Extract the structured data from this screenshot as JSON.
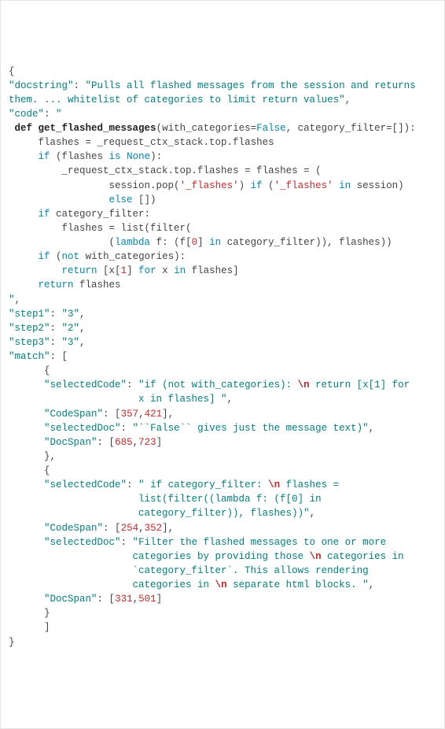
{
  "lines": {
    "l0": "{",
    "l1_key": "\"docstring\"",
    "l1_val_a": "\"Pulls all flashed messages from the session and returns",
    "l1_val_b": "them. ... whitelist of categories to limit return values\"",
    "l2_key": "\"code\"",
    "l2_q": "\"",
    "code_def": "def ",
    "code_fn": "get_flashed_messages",
    "code_sig_a": "(with_categories=",
    "code_false": "False",
    "code_sig_b": ", category_filter=[]):",
    "code_l2": "    flashes = _request_ctx_stack.top.flashes",
    "code_l3_if": "    if ",
    "code_l3_rest": "(flashes ",
    "code_l3_is": "is ",
    "code_l3_none": "None",
    "code_l3_end": "):",
    "code_l4": "        _request_ctx_stack.top.flashes = flashes = (",
    "code_l5_a": "                session.pop(",
    "code_l5_str": "'_flashes'",
    "code_l5_b": ") ",
    "code_l5_if": "if ",
    "code_l5_c": "(",
    "code_l5_str2": "'_flashes'",
    "code_l5_in": " in ",
    "code_l5_d": "session)",
    "code_l6_else": "                else ",
    "code_l6_b": "[])",
    "code_l7_if": "    if ",
    "code_l7_rest": "category_filter:",
    "code_l8": "        flashes = list(filter(",
    "code_l9_a": "                (",
    "code_l9_lambda": "lambda ",
    "code_l9_b": "f: (f[",
    "code_l9_0": "0",
    "code_l9_c": "] ",
    "code_l9_in": "in ",
    "code_l9_d": "category_filter)), flashes))",
    "code_l10_if": "    if ",
    "code_l10_a": "(",
    "code_l10_not": "not ",
    "code_l10_b": "with_categories):",
    "code_l11_ret": "        return ",
    "code_l11_a": "[x[",
    "code_l11_1": "1",
    "code_l11_b": "] ",
    "code_l11_for": "for ",
    "code_l11_c": "x ",
    "code_l11_in": "in ",
    "code_l11_d": "flashes]",
    "code_l12_ret": "    return ",
    "code_l12_a": "flashes",
    "code_end": "\"",
    "step1_key": "\"step1\"",
    "step1_val": "\"3\"",
    "step2_key": "\"step2\"",
    "step2_val": "\"2\"",
    "step3_key": "\"step3\"",
    "step3_val": "\"3\"",
    "match_key": "\"match\"",
    "match_open": "[",
    "m_obj_open": "{",
    "m1_sc_key": "\"selectedCode\"",
    "m1_sc_val_a": "\"if (not with_categories): ",
    "m1_sc_esc": "\\n",
    "m1_sc_val_b": " return [x[1] for",
    "m1_sc_val_c": "x in flashes] \"",
    "m1_cs_key": "\"CodeSpan\"",
    "m1_cs_a": "357",
    "m1_cs_b": "421",
    "m1_sd_key": "\"selectedDoc\"",
    "m1_sd_val": "\"``False`` gives just the message text)\"",
    "m1_ds_key": "\"DocSpan\"",
    "m1_ds_a": "685",
    "m1_ds_b": "723",
    "m_obj_close": "}",
    "m_comma": ",",
    "m2_sc_key": "\"selectedCode\"",
    "m2_sc_val_a": "\" if category_filter: ",
    "m2_sc_esc": "\\n",
    "m2_sc_val_b": " flashes =",
    "m2_sc_val_c": "list(filter((lambda f: (f[0] in",
    "m2_sc_val_d": "category_filter)), flashes))\"",
    "m2_cs_key": "\"CodeSpan\"",
    "m2_cs_a": "254",
    "m2_cs_b": "352",
    "m2_sd_key": "\"selectedDoc\"",
    "m2_sd_val_a": "\"Filter the flashed messages to one or more",
    "m2_sd_esc1": "\\n",
    "m2_sd_val_b": " categories in",
    "m2_sd_val_b0": "categories by providing those ",
    "m2_sd_val_c": "`category_filter`. This allows rendering",
    "m2_sd_val_d": "categories in ",
    "m2_sd_esc2": "\\n",
    "m2_sd_val_e": " separate html blocks. \"",
    "m2_ds_key": "\"DocSpan\"",
    "m2_ds_a": "331",
    "m2_ds_b": "501",
    "match_close": "]",
    "l_end": "}"
  }
}
